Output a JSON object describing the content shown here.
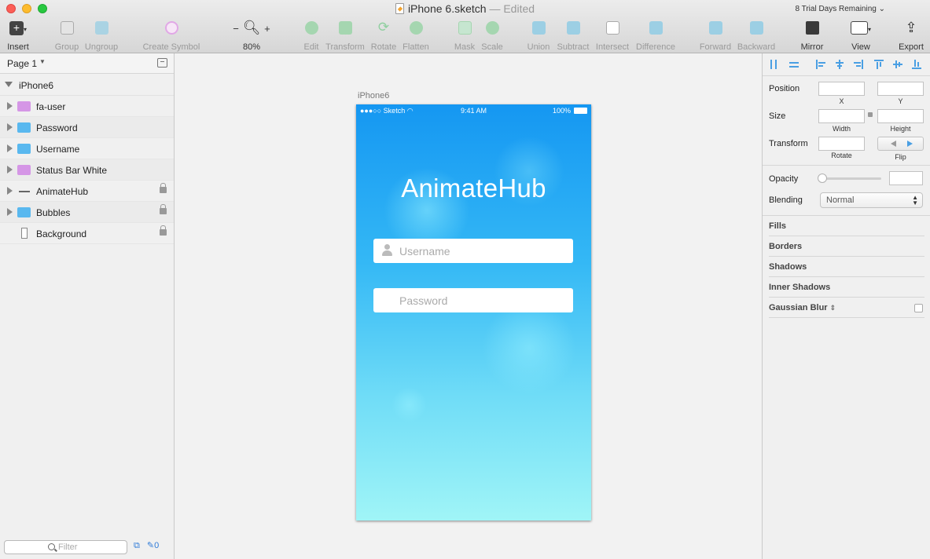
{
  "window": {
    "doc_title": "iPhone 6.sketch",
    "edited_label": "— Edited",
    "trial_notice": "8 Trial Days Remaining"
  },
  "toolbar": {
    "insert": "Insert",
    "group": "Group",
    "ungroup": "Ungroup",
    "create_symbol": "Create Symbol",
    "zoom_value": "80%",
    "edit": "Edit",
    "transform": "Transform",
    "rotate": "Rotate",
    "flatten": "Flatten",
    "mask": "Mask",
    "scale": "Scale",
    "union": "Union",
    "subtract": "Subtract",
    "intersect": "Intersect",
    "difference": "Difference",
    "forward": "Forward",
    "backward": "Backward",
    "mirror": "Mirror",
    "view": "View",
    "export": "Export"
  },
  "layers_panel": {
    "page_name": "Page 1",
    "artboard": "iPhone6",
    "layers": [
      {
        "name": "fa-user",
        "icon": "folder-icon",
        "color": "#d596e6"
      },
      {
        "name": "Password",
        "icon": "folder-icon",
        "color": "#59b8ef"
      },
      {
        "name": "Username",
        "icon": "folder-icon",
        "color": "#59b8ef"
      },
      {
        "name": "Status Bar White",
        "icon": "folder-icon",
        "color": "#d596e6"
      },
      {
        "name": "AnimateHub",
        "icon": "line-icon",
        "locked": true
      },
      {
        "name": "Bubbles",
        "icon": "folder-icon",
        "color": "#59b8ef",
        "locked": true
      },
      {
        "name": "Background",
        "icon": "rectangle-icon",
        "locked": true
      }
    ],
    "filter_placeholder": "Filter",
    "slice_count": "0"
  },
  "canvas": {
    "artboard_label": "iPhone6",
    "status_bar": {
      "carrier": "●●●○○ Sketch",
      "time": "9:41 AM",
      "battery": "100%"
    },
    "app_title": "AnimateHub",
    "username_placeholder": "Username",
    "password_placeholder": "Password",
    "gradient_top": "#1597f2",
    "gradient_bottom": "#a0f5f7"
  },
  "inspector": {
    "position": "Position",
    "x": "X",
    "y": "Y",
    "size": "Size",
    "width": "Width",
    "height": "Height",
    "transform": "Transform",
    "rotate": "Rotate",
    "flip": "Flip",
    "opacity": "Opacity",
    "blending": "Blending",
    "blending_value": "Normal",
    "fills": "Fills",
    "borders": "Borders",
    "shadows": "Shadows",
    "inner_shadows": "Inner Shadows",
    "gaussian_blur": "Gaussian Blur",
    "accent": "#4a9fe3"
  }
}
